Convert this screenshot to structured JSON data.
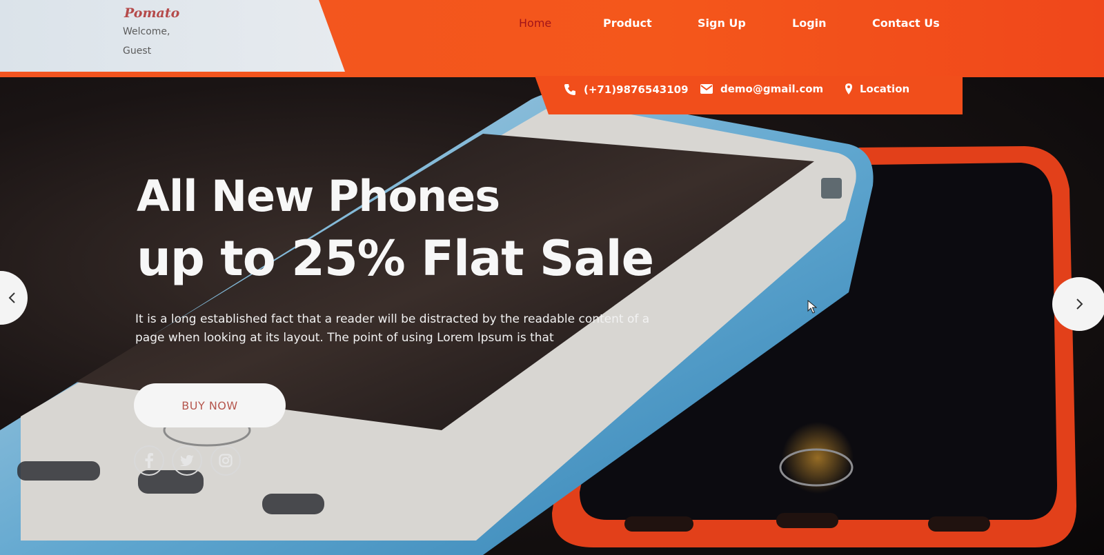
{
  "brand": {
    "logo": "Pomato",
    "greeting_line1": "Welcome,",
    "greeting_line2": "Guest"
  },
  "nav": {
    "items": [
      {
        "label": "Home",
        "active": true
      },
      {
        "label": "Product",
        "active": false
      },
      {
        "label": "Sign Up",
        "active": false
      },
      {
        "label": "Login",
        "active": false
      },
      {
        "label": "Contact Us",
        "active": false
      }
    ]
  },
  "contact": {
    "phone": "(+71)9876543109",
    "email": "demo@gmail.com",
    "location": "Location"
  },
  "hero": {
    "title_line1": "All New Phones",
    "title_line2": "up to 25% Flat Sale",
    "description": "It is a long established fact that a reader will be distracted by the readable content of a page when looking at its layout. The point of using Lorem Ipsum is that",
    "cta_label": "BUY NOW"
  },
  "social": [
    "facebook-icon",
    "twitter-icon",
    "instagram-icon"
  ],
  "colors": {
    "accent": "#f25420",
    "active_nav": "#a2141a",
    "cta_text": "#b5564d"
  }
}
